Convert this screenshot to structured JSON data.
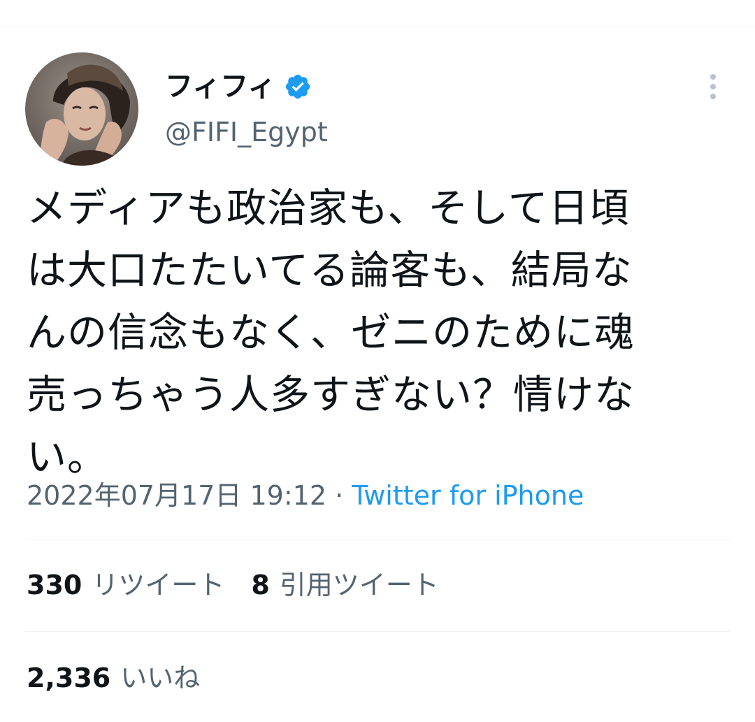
{
  "author": {
    "display_name": "フィフィ",
    "handle": "@FIFI_Egypt",
    "verified": true,
    "badge_color": "#1d9bf0"
  },
  "tweet": {
    "text": "メディアも政治家も、そして日頃\nは大口たたいてる論客も、結局な\nんの信念もなく、ゼニのために魂\n売っちゃう人多すぎない？情けな\nい。",
    "timestamp": "2022年07月17日 19:12",
    "separator": "·",
    "source": "Twitter for iPhone"
  },
  "stats": {
    "retweets_count": "330",
    "retweets_label": "リツイート",
    "quotes_count": "8",
    "quotes_label": "引用ツイート",
    "likes_count": "2,336",
    "likes_label": "いいね"
  },
  "colors": {
    "text_primary": "#0f1419",
    "text_secondary": "#536471",
    "link": "#1d9bf0",
    "divider": "#eff3f4"
  },
  "icons": {
    "verified": "verified-badge-icon",
    "more": "more-vertical-icon"
  }
}
